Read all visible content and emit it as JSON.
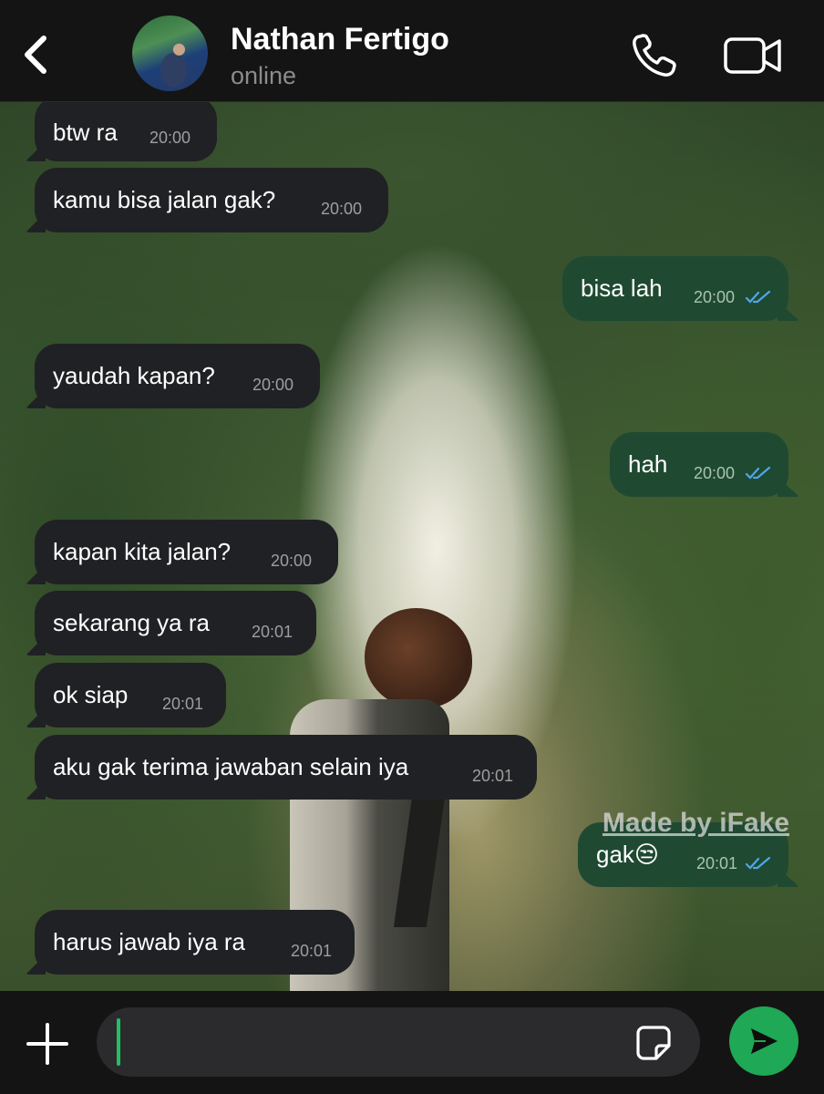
{
  "header": {
    "back_icon": "chevron-left-icon",
    "contact_name": "Nathan Fertigo",
    "status": "online",
    "call_icon": "phone-icon",
    "video_icon": "video-camera-icon"
  },
  "messages": [
    {
      "dir": "in",
      "text": "btw ra",
      "time": "20:00"
    },
    {
      "dir": "in",
      "text": "kamu bisa jalan gak?",
      "time": "20:00"
    },
    {
      "dir": "out",
      "text": "bisa lah",
      "time": "20:00",
      "read": true
    },
    {
      "dir": "in",
      "text": "yaudah kapan?",
      "time": "20:00"
    },
    {
      "dir": "out",
      "text": "hah",
      "time": "20:00",
      "read": true
    },
    {
      "dir": "in",
      "text": "kapan kita jalan?",
      "time": "20:00"
    },
    {
      "dir": "in",
      "text": "sekarang ya ra",
      "time": "20:01"
    },
    {
      "dir": "in",
      "text": "ok siap",
      "time": "20:01"
    },
    {
      "dir": "in",
      "text": "aku gak terima jawaban selain iya",
      "time": "20:01"
    },
    {
      "dir": "out",
      "text": "gak😒",
      "time": "20:01",
      "read": true
    },
    {
      "dir": "in",
      "text": "harus jawab iya ra",
      "time": "20:01"
    }
  ],
  "watermark": "Made by iFake",
  "composer": {
    "plus_icon": "plus-icon",
    "value": "",
    "placeholder": "",
    "sticker_icon": "sticker-icon",
    "send_icon": "send-icon"
  },
  "colors": {
    "accent": "#1fa855",
    "outgoing_bubble": "#1f4a31",
    "incoming_bubble": "#202124",
    "read_ticks": "#4fa6e8"
  }
}
